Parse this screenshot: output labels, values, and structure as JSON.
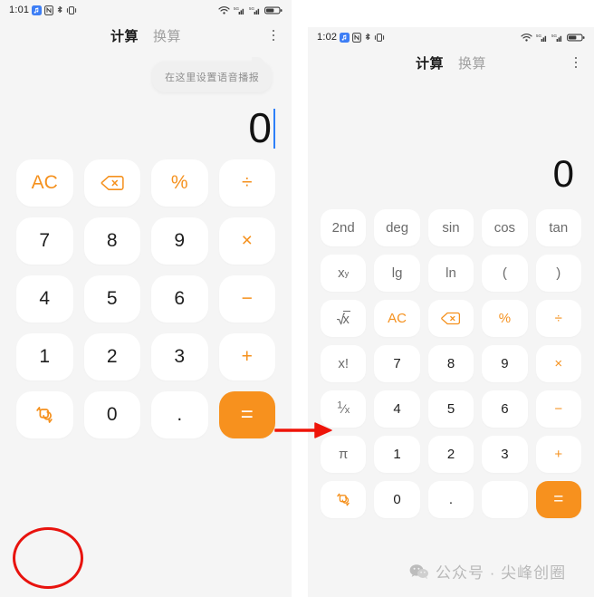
{
  "accent_color": "#f5911e",
  "equals_bg": "#f7911e",
  "caret_color": "#2d7ff9",
  "annotation_color": "#e8130e",
  "panel_bg": "#f5f5f5",
  "key_bg": "#ffffff",
  "left_phone": {
    "status_bar": {
      "time": "1:01",
      "left_icons": [
        "music-icon",
        "nfc-icon",
        "bluetooth-icon",
        "vibrate-icon"
      ],
      "right_icons": [
        "wifi-icon",
        "signal-sim1-icon",
        "signal-sim2-icon",
        "battery-icon"
      ]
    },
    "header": {
      "tabs": [
        {
          "label": "计算",
          "active": true
        },
        {
          "label": "换算",
          "active": false
        }
      ],
      "more_icon": "overflow-menu-icon"
    },
    "tooltip": {
      "text": "在这里设置语音播报"
    },
    "display": {
      "value": "0",
      "caret": true
    },
    "keys": [
      {
        "label": "AC",
        "style": "accent"
      },
      {
        "label": "",
        "style": "accent",
        "icon": "backspace-icon"
      },
      {
        "label": "%",
        "style": "accent"
      },
      {
        "label": "÷",
        "style": "accent"
      },
      {
        "label": "7",
        "style": "normal"
      },
      {
        "label": "8",
        "style": "normal"
      },
      {
        "label": "9",
        "style": "normal"
      },
      {
        "label": "×",
        "style": "accent"
      },
      {
        "label": "4",
        "style": "normal"
      },
      {
        "label": "5",
        "style": "normal"
      },
      {
        "label": "6",
        "style": "normal"
      },
      {
        "label": "−",
        "style": "accent"
      },
      {
        "label": "1",
        "style": "normal"
      },
      {
        "label": "2",
        "style": "normal"
      },
      {
        "label": "3",
        "style": "normal"
      },
      {
        "label": "+",
        "style": "accent"
      },
      {
        "label": "",
        "style": "accent",
        "icon": "scientific-toggle-icon"
      },
      {
        "label": "0",
        "style": "normal"
      },
      {
        "label": ".",
        "style": "normal"
      },
      {
        "label": "=",
        "style": "equals"
      }
    ]
  },
  "right_phone": {
    "status_bar": {
      "time": "1:02",
      "left_icons": [
        "music-icon",
        "nfc-icon",
        "bluetooth-icon",
        "vibrate-icon"
      ],
      "right_icons": [
        "wifi-icon",
        "signal-sim1-icon",
        "signal-sim2-icon",
        "battery-icon"
      ]
    },
    "header": {
      "tabs": [
        {
          "label": "计算",
          "active": true
        },
        {
          "label": "换算",
          "active": false
        }
      ],
      "more_icon": "overflow-menu-icon"
    },
    "display": {
      "value": "0",
      "caret": false
    },
    "keys": [
      {
        "label": "2nd",
        "style": "fn"
      },
      {
        "label": "deg",
        "style": "fn"
      },
      {
        "label": "sin",
        "style": "fn"
      },
      {
        "label": "cos",
        "style": "fn"
      },
      {
        "label": "tan",
        "style": "fn"
      },
      {
        "label": "xʸ",
        "style": "fn",
        "sup": {
          "base": "x",
          "exp": "y"
        }
      },
      {
        "label": "lg",
        "style": "fn"
      },
      {
        "label": "ln",
        "style": "fn"
      },
      {
        "label": "(",
        "style": "fn"
      },
      {
        "label": ")",
        "style": "fn"
      },
      {
        "label": "√x",
        "style": "fn",
        "icon": "sqrt-icon"
      },
      {
        "label": "AC",
        "style": "accent"
      },
      {
        "label": "",
        "style": "accent",
        "icon": "backspace-icon"
      },
      {
        "label": "%",
        "style": "accent"
      },
      {
        "label": "÷",
        "style": "accent"
      },
      {
        "label": "x!",
        "style": "fn"
      },
      {
        "label": "7",
        "style": "normal"
      },
      {
        "label": "8",
        "style": "normal"
      },
      {
        "label": "9",
        "style": "normal"
      },
      {
        "label": "×",
        "style": "accent"
      },
      {
        "label": "1/x",
        "style": "fn",
        "icon": "reciprocal-icon"
      },
      {
        "label": "4",
        "style": "normal"
      },
      {
        "label": "5",
        "style": "normal"
      },
      {
        "label": "6",
        "style": "normal"
      },
      {
        "label": "−",
        "style": "accent"
      },
      {
        "label": "π",
        "style": "fn"
      },
      {
        "label": "1",
        "style": "normal"
      },
      {
        "label": "2",
        "style": "normal"
      },
      {
        "label": "3",
        "style": "normal"
      },
      {
        "label": "+",
        "style": "accent"
      },
      {
        "label": "",
        "style": "accent",
        "icon": "scientific-toggle-icon"
      },
      {
        "label": "0",
        "style": "normal"
      },
      {
        "label": ".",
        "style": "normal"
      },
      {
        "label": "",
        "style": "normal"
      },
      {
        "label": "=",
        "style": "equals"
      }
    ]
  },
  "annotations": {
    "circle_target": "scientific-toggle-key",
    "arrow_direction": "right"
  },
  "watermark": {
    "text": "公众号 · 尖峰创圈",
    "logo": "wechat-icon"
  }
}
